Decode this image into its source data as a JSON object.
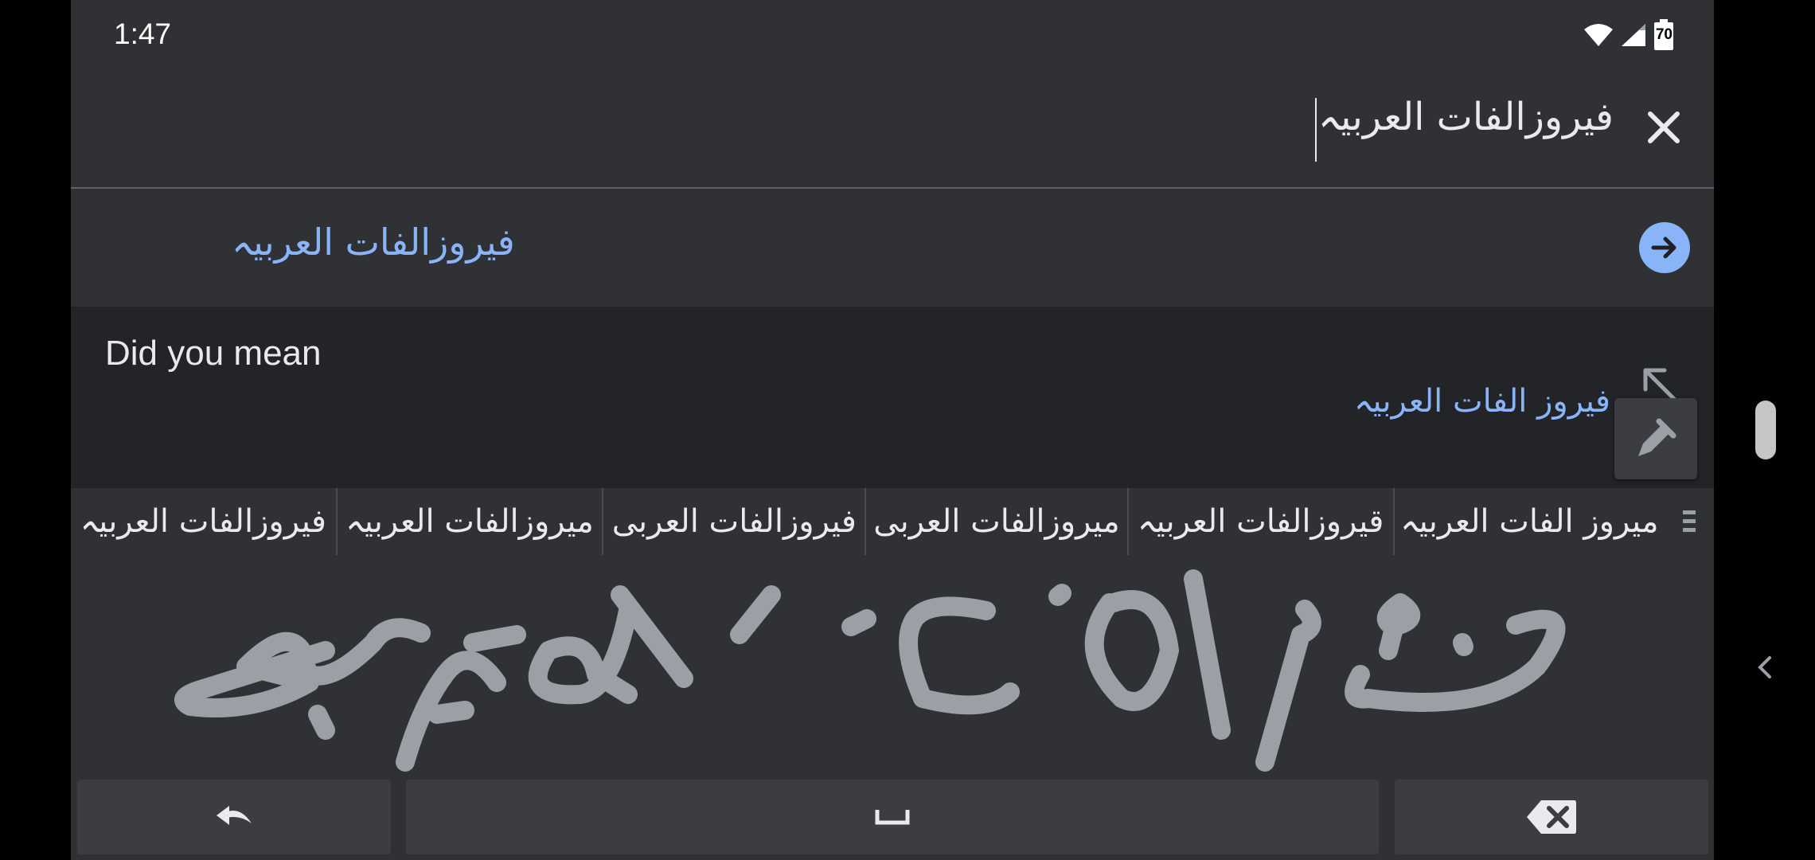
{
  "status_bar": {
    "time": "1:47",
    "battery": "70",
    "icons": [
      "wifi-icon",
      "signal-icon",
      "battery-icon"
    ]
  },
  "search": {
    "query": "فيروزالفات العربيہ",
    "clear_icon": "close-icon"
  },
  "suggestion": {
    "text": "فيروزالفات العربيہ",
    "go_icon": "arrow-right-icon"
  },
  "did_you_mean": {
    "label": "Did you mean",
    "correction": "فيروز الفات العربيہ",
    "fill_icon": "arrow-up-left-icon"
  },
  "pen_button": {
    "icon": "pen-icon"
  },
  "candidates": [
    "ميروز الفات العربيہ",
    "قيروزالفات العربيہ",
    "ميروزالفات العربى",
    "فيروزالفات العربى",
    "ميروزالفات العربيہ",
    "فيروزالفات العربيہ"
  ],
  "candidates_more_icon": "more-vertical-icon",
  "keyboard": {
    "undo_icon": "undo-icon",
    "space_icon": "space-icon",
    "backspace_icon": "backspace-icon"
  },
  "colors": {
    "background": "#303134",
    "accent": "#8ab4f8",
    "ink": "#9aa0a6"
  }
}
